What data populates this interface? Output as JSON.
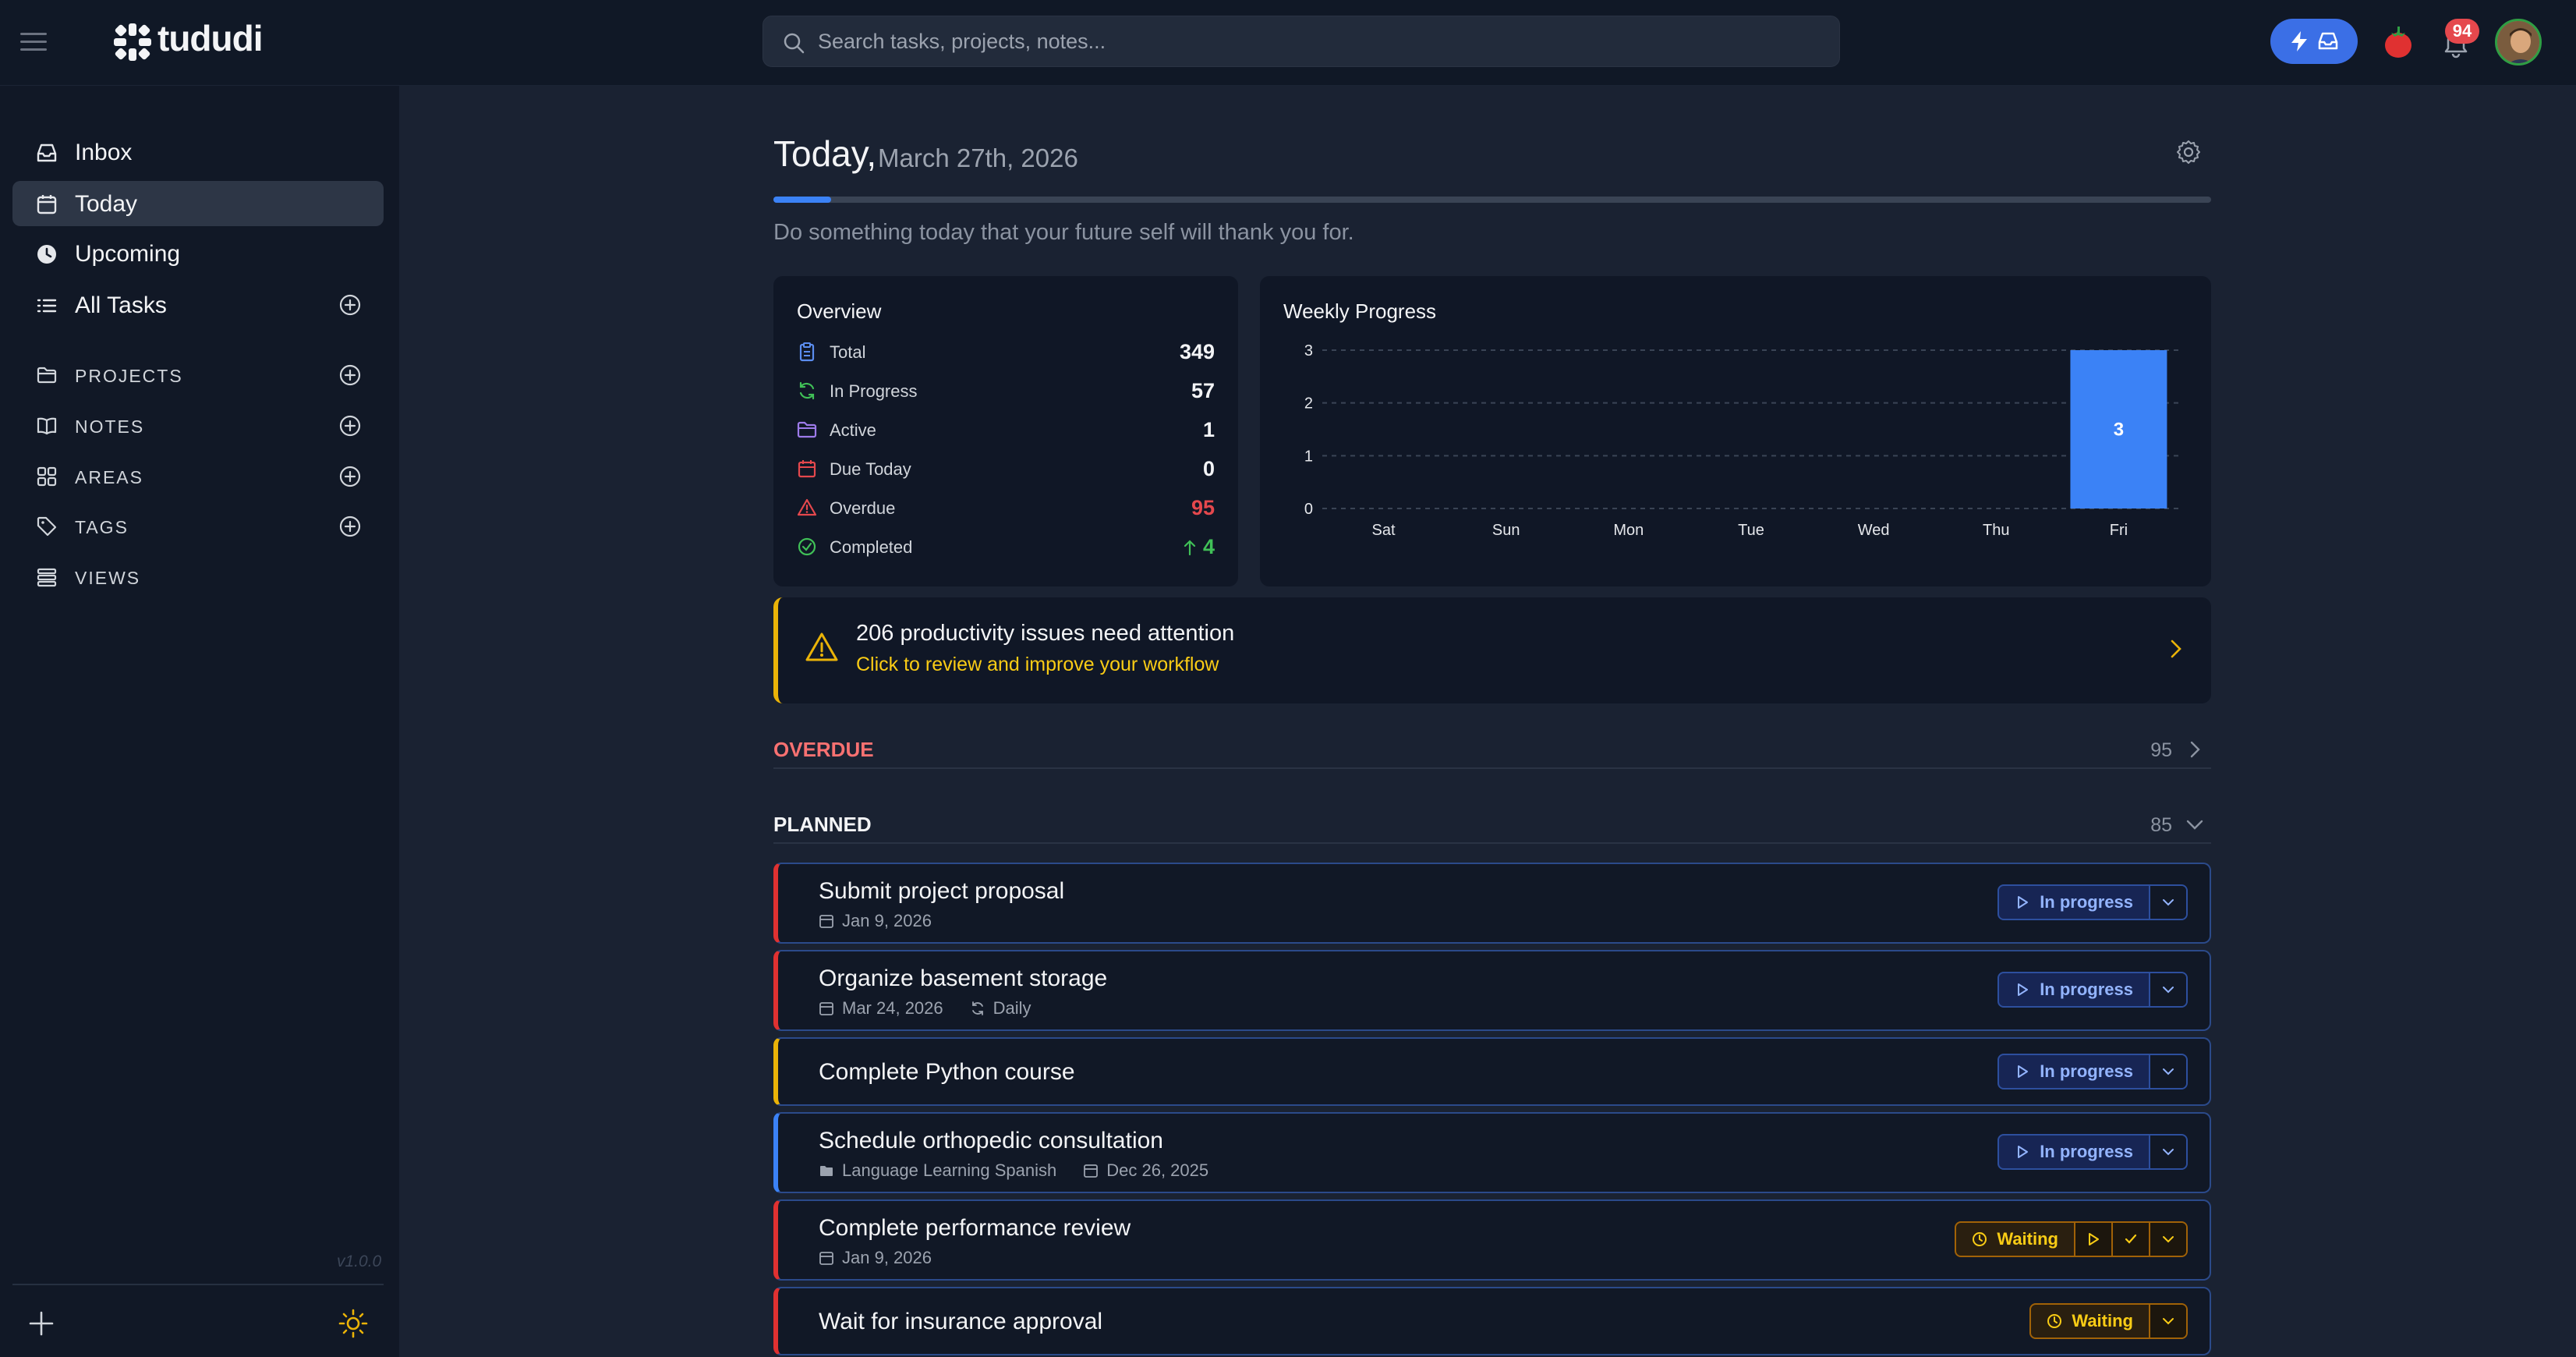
{
  "app": {
    "name": "tududi",
    "version": "v1.0.0"
  },
  "search": {
    "placeholder": "Search tasks, projects, notes..."
  },
  "notifications": {
    "count": "94"
  },
  "sidebar": {
    "nav": [
      {
        "label": "Inbox",
        "icon": "inbox-icon"
      },
      {
        "label": "Today",
        "icon": "calendar-icon",
        "active": true
      },
      {
        "label": "Upcoming",
        "icon": "clock-icon"
      },
      {
        "label": "All Tasks",
        "icon": "list-icon"
      }
    ],
    "sections": [
      {
        "label": "PROJECTS",
        "icon": "folder-icon"
      },
      {
        "label": "NOTES",
        "icon": "book-icon"
      },
      {
        "label": "AREAS",
        "icon": "grid-icon"
      },
      {
        "label": "TAGS",
        "icon": "tag-icon"
      },
      {
        "label": "VIEWS",
        "icon": "stack-icon"
      }
    ]
  },
  "page": {
    "title": "Today,",
    "date": "March 27th, 2026",
    "progress": 0.04,
    "quote": "Do something today that your future self will thank you for."
  },
  "overview": {
    "title": "Overview",
    "rows": [
      {
        "label": "Total",
        "value": "349",
        "icon": "clipboard-icon",
        "color": "#5b8def"
      },
      {
        "label": "In Progress",
        "value": "57",
        "icon": "refresh-icon",
        "color": "#40c057"
      },
      {
        "label": "Active",
        "value": "1",
        "icon": "folder-icon",
        "color": "#9d7bea"
      },
      {
        "label": "Due Today",
        "value": "0",
        "icon": "calendar-icon",
        "color": "#e5484d"
      },
      {
        "label": "Overdue",
        "value": "95",
        "icon": "warning-icon",
        "color": "#e5484d"
      },
      {
        "label": "Completed",
        "value": "4",
        "icon": "check-circle-icon",
        "color": "#40c057"
      }
    ]
  },
  "chart_data": {
    "type": "bar",
    "title": "Weekly Progress",
    "categories": [
      "Sat",
      "Sun",
      "Mon",
      "Tue",
      "Wed",
      "Thu",
      "Fri"
    ],
    "values": [
      0,
      0,
      0,
      0,
      0,
      0,
      3
    ],
    "data_labels": [
      "",
      "",
      "",
      "",
      "",
      "",
      "3"
    ],
    "ylim": [
      0,
      3
    ],
    "yticks": [
      "0",
      "1",
      "2",
      "3"
    ],
    "grid": true,
    "bar_color": "#3b82f6"
  },
  "alert": {
    "title": "206 productivity issues need attention",
    "subtitle": "Click to review and improve your workflow"
  },
  "groups": {
    "overdue": {
      "label": "OVERDUE",
      "count": "95",
      "color": "#f87171"
    },
    "planned": {
      "label": "PLANNED",
      "count": "85",
      "color": "#f3f4f6"
    }
  },
  "tasks": [
    {
      "title": "Submit project proposal",
      "date": "Jan 9, 2026",
      "status": "In progress",
      "accent": "red"
    },
    {
      "title": "Organize basement storage",
      "date": "Mar 24, 2026",
      "repeat": "Daily",
      "status": "In progress",
      "accent": "red"
    },
    {
      "title": "Complete Python course",
      "status": "In progress",
      "accent": "yellow"
    },
    {
      "title": "Schedule orthopedic consultation",
      "project": "Language Learning Spanish",
      "date": "Dec 26, 2025",
      "status": "In progress",
      "accent": "blue"
    },
    {
      "title": "Complete performance review",
      "date": "Jan 9, 2026",
      "status": "Waiting",
      "accent": "red"
    },
    {
      "title": "Wait for insurance approval",
      "status": "Waiting",
      "accent": "red"
    }
  ]
}
